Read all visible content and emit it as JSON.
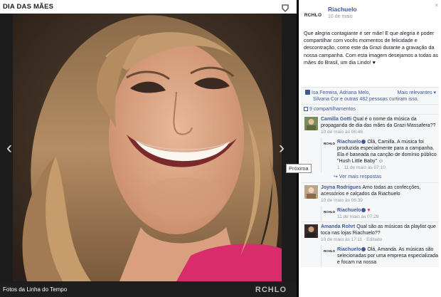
{
  "album": {
    "title": "DIA DAS MÃES",
    "bottom_link": "Fotos da Linha do Tempo",
    "watermark": "RCHLO",
    "next_tooltip": "Próxima"
  },
  "page": {
    "avatar_text": "RCHLO",
    "name": "Riachuelo",
    "time": "10 de maio",
    "close_glyph": "×"
  },
  "post": {
    "text": "Que alegria contagiante é ser mãe! E que alegria é poder compartilhar com vocês momentos de felicidade e descontração, como este da Grazi durante a gravação da nossa campanha. Com esta imagem desejamos a todas as mães do Brasil, um dia Lindo! ♥"
  },
  "likes": {
    "names": "Isa Ferreira, Adriana Melo,",
    "more_relevant": "Mais relevantes ▾",
    "line2": "Silvana Cor e outras 482 pessoas curtiram isso.",
    "shares": "9 compartilhamentos"
  },
  "comments": [
    {
      "author": "Camilla Gotti",
      "text": "Qual é o nome da música da propaganda de dia das mães da Grazi Massafera??",
      "meta": "10 de maio às 06:46",
      "avatar_color": "#7a8c5c",
      "replies": [
        {
          "author": "Riachuelo",
          "text": "Olá, Camilla. A música foi produzida especialmente para a campanha. Ela é baseada na canção de domínio público \"Hush Little Baby\" ☺",
          "meta": "1 · 11 de maio às 07:10"
        }
      ],
      "more_replies": "↪ Ver mais respostas"
    },
    {
      "author": "Joyna Rodrigues",
      "text": "Amo todas as confecções, acessórios e calçados da Riachuelo",
      "meta": "10 de maio às 06:39",
      "avatar_color": "#b9a58a",
      "replies": [
        {
          "author": "Riachuelo",
          "text": "♥",
          "meta": "11 de maio às 07:29"
        }
      ]
    },
    {
      "author": "Amanda Rohrt",
      "text": "Qual são as músicas da playlist que toca nas lojas Riachuelo??",
      "meta": "10 de maio às 17:11 · Editado",
      "avatar_color": "#3a2a2a",
      "replies": [
        {
          "author": "Riachuelo",
          "text": "Olá, Amanda. As músicas são selecionadas por uma empresa especializada e focam na nossa",
          "meta": ""
        }
      ]
    }
  ]
}
